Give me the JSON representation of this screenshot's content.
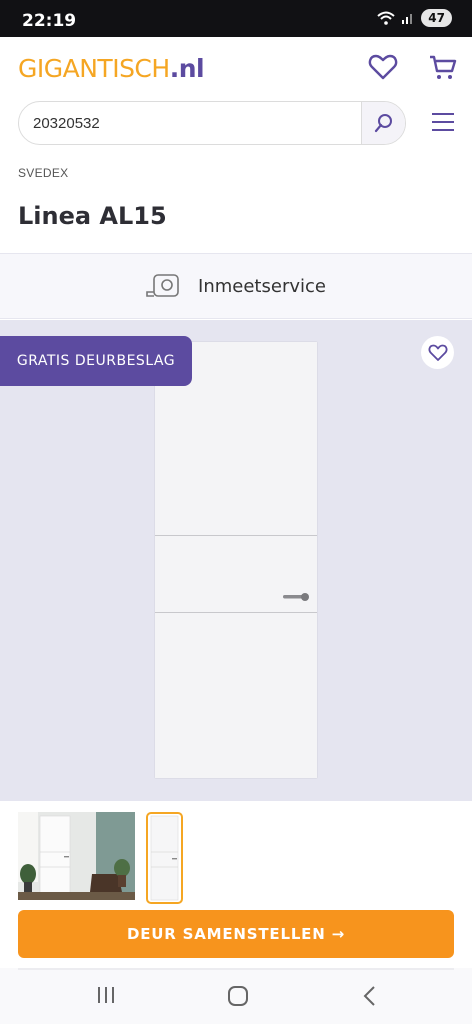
{
  "status_bar": {
    "time": "22:19",
    "battery": "47"
  },
  "header": {
    "logo_part1": "GIGANTISCH",
    "logo_part2": ".nl"
  },
  "search": {
    "value": "20320532",
    "placeholder": ""
  },
  "product": {
    "brand": "SVEDEX",
    "title": "Linea AL15"
  },
  "measure_service": {
    "label": "Inmeetservice"
  },
  "gallery": {
    "badge": "GRATIS DEURBESLAG"
  },
  "cta": {
    "label": "DEUR SAMENSTELLEN →"
  },
  "colors": {
    "brand_orange": "#f7941d",
    "brand_purple": "#5c4ba0",
    "gallery_bg": "#e5e5f0"
  }
}
